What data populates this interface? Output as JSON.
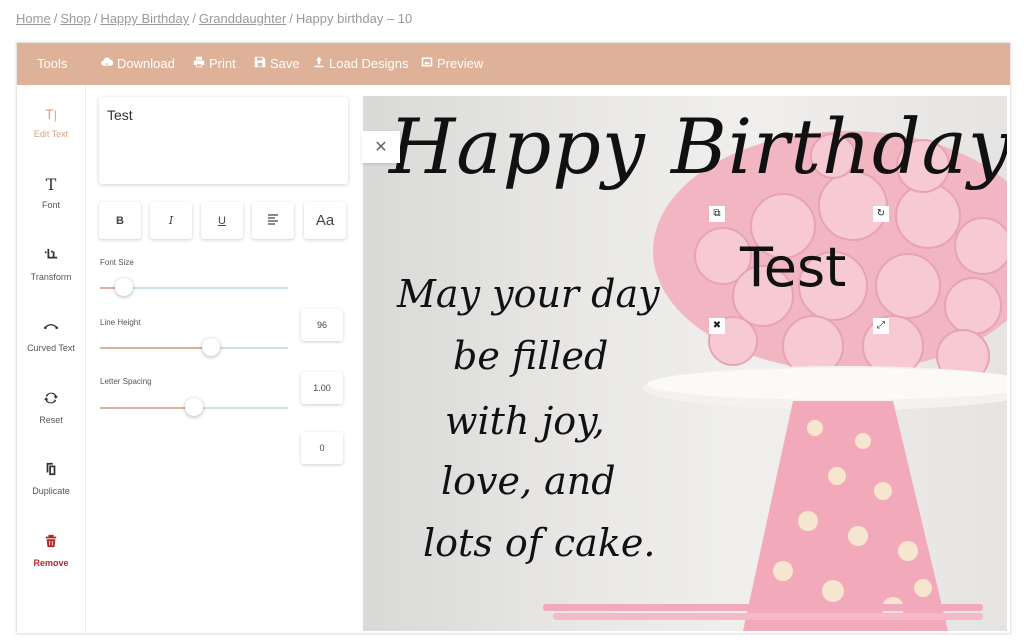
{
  "breadcrumbs": {
    "home": "Home",
    "shop": "Shop",
    "happy_birthday": "Happy Birthday",
    "granddaughter": "Granddaughter",
    "current": "Happy birthday – 10",
    "separator": "/"
  },
  "toolbar": {
    "tools_label": "Tools",
    "download": "Download",
    "print": "Print",
    "save": "Save",
    "load_designs": "Load Designs",
    "preview": "Preview"
  },
  "sidebar": {
    "items": [
      {
        "label": "Edit Text",
        "icon": "edit-text-icon"
      },
      {
        "label": "Font",
        "icon": "font-icon"
      },
      {
        "label": "Transform",
        "icon": "crop-icon"
      },
      {
        "label": "Curved Text",
        "icon": "curve-icon"
      },
      {
        "label": "Reset",
        "icon": "reset-icon"
      },
      {
        "label": "Duplicate",
        "icon": "duplicate-icon"
      },
      {
        "label": "Remove",
        "icon": "trash-icon"
      }
    ]
  },
  "editor": {
    "text_value": "Test",
    "format_buttons": {
      "bold": "B",
      "italic": "I",
      "underline": "U",
      "case": "Aa"
    },
    "font_size": {
      "label": "Font Size",
      "value": "96",
      "fraction": 0.13
    },
    "line_height": {
      "label": "Line Height",
      "value": "1.00",
      "fraction": 0.59
    },
    "letter_spacing": {
      "label": "Letter Spacing",
      "value": "0",
      "fraction": 0.5
    }
  },
  "canvas": {
    "title": "Happy Birthday",
    "selected_text": "Test",
    "message_lines": [
      "May your day",
      "be filled",
      "with joy,",
      "love, and",
      "lots of cake."
    ]
  },
  "colors": {
    "accent": "#deb298",
    "remove": "#b02a2a",
    "cake_pink": "#f3b7c4"
  }
}
